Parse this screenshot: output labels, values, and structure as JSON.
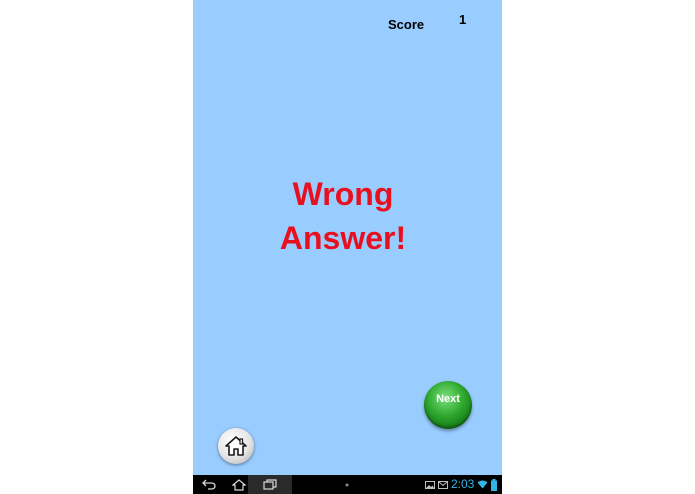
{
  "score": {
    "label": "Score",
    "value": "1"
  },
  "result": {
    "line1": "Wrong",
    "line2": "Answer!"
  },
  "next_button": {
    "label": "Next"
  },
  "status_bar": {
    "time": "2:03"
  },
  "icons": {
    "home": "home-icon",
    "back": "back-icon",
    "nav_home": "nav-home-icon",
    "recent_apps": "recent-apps-icon",
    "gallery": "gallery-icon",
    "mail": "mail-icon",
    "wifi": "wifi-icon",
    "battery": "battery-icon"
  },
  "colors": {
    "background": "#99ccff",
    "result_text": "#e8101e",
    "next_button": "#2ea82e",
    "clock": "#33b5e5"
  }
}
